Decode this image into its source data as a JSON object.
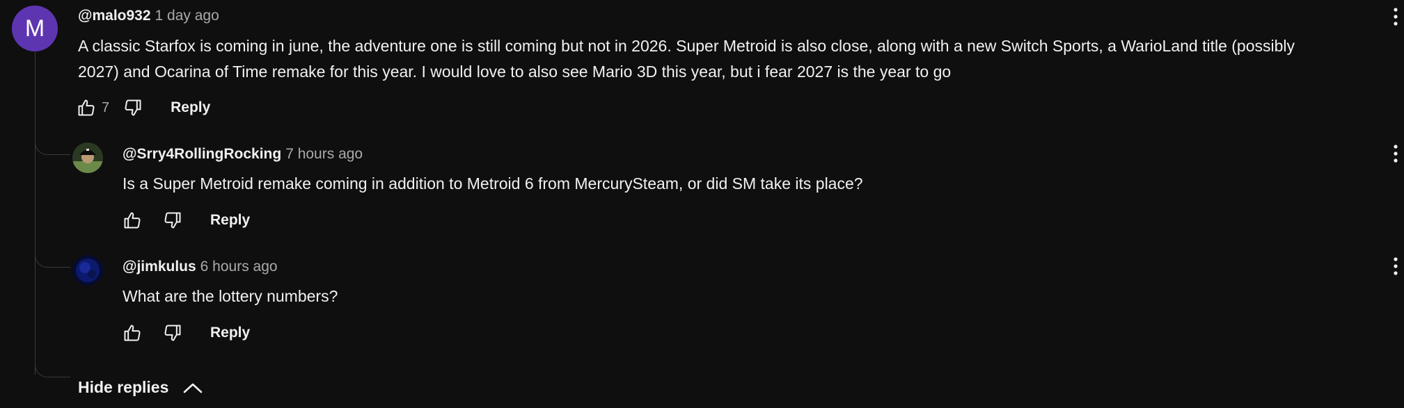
{
  "comment": {
    "avatar_letter": "M",
    "avatar_color": "#5e35b1",
    "handle": "@malo932",
    "time": "1 day ago",
    "text_line1": "A classic Starfox is coming in june, the adventure one is still coming but not in 2026. Super Metroid is also close, along with a new Switch Sports, a WarioLand title (possibly",
    "text_line2": "2027) and Ocarina of Time remake for this year. I would love to also see Mario 3D this year, but i fear 2027 is the year to go",
    "like_count": "7",
    "reply_label": "Reply"
  },
  "replies": [
    {
      "handle": "@Srry4RollingRocking",
      "time": "7 hours ago",
      "text": "Is a Super Metroid remake coming in addition to Metroid 6 from MercurySteam, or did SM take its place?",
      "reply_label": "Reply"
    },
    {
      "handle": "@jimkulus",
      "time": "6 hours ago",
      "text": "What are the lottery numbers?",
      "reply_label": "Reply"
    }
  ],
  "hide_replies_label": "Hide replies",
  "icons": {
    "like": "thumbs-up-icon",
    "dislike": "thumbs-down-icon",
    "menu": "more-vert-icon",
    "collapse": "chevron-up-icon"
  },
  "colors": {
    "background": "#0f0f0f",
    "text": "#f1f1f1",
    "secondary_text": "#aaaaaa"
  }
}
